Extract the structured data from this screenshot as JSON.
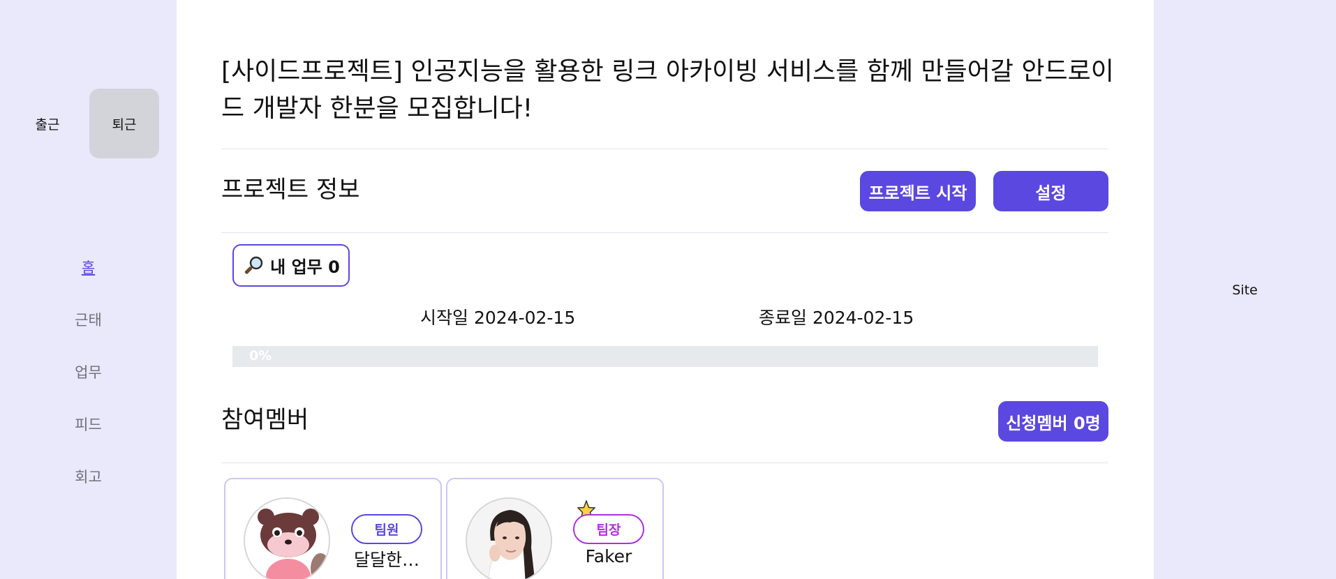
{
  "attendance": {
    "check_in": "출근",
    "check_out": "퇴근"
  },
  "nav": {
    "items": [
      "홈",
      "근태",
      "업무",
      "피드",
      "회고"
    ]
  },
  "project": {
    "title": "[사이드프로젝트] 인공지능을 활용한 링크 아카이빙 서비스를 함께 만들어갈 안드로이드 개발자 한분을 모집합니다!",
    "info_heading": "프로젝트 정보",
    "start_button": "프로젝트 시작",
    "settings_button": "설정",
    "my_tasks": "내 업무 0",
    "start_date": "시작일 2024-02-15",
    "end_date": "종료일 2024-02-15",
    "progress_label": "0%",
    "progress_value": 0
  },
  "members": {
    "heading": "참여멤버",
    "applicants_button": "신청멤버 0명",
    "list": [
      {
        "role": "팀원",
        "name": "달달한…",
        "avatar": "raccoon-avatar"
      },
      {
        "role": "팀장",
        "name": "Faker",
        "avatar": "photo-avatar"
      }
    ]
  },
  "right_panel": {
    "label": "Site"
  },
  "colors": {
    "accent": "#5b48e0",
    "leader": "#b12ee0",
    "bg": "#eae8fb"
  }
}
